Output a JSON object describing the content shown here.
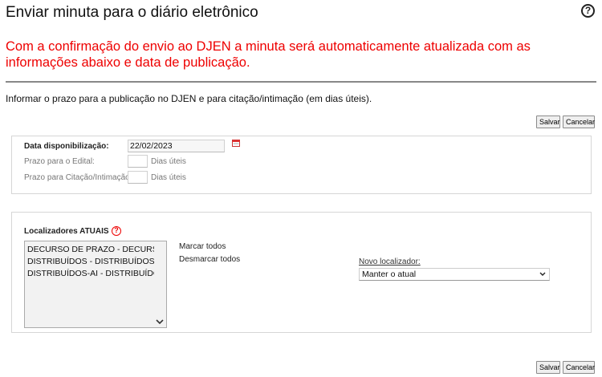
{
  "header": {
    "title": "Enviar minuta para o diário eletrônico",
    "help_icon": "question-circle-icon"
  },
  "warning": "Com a confirmação do envio ao DJEN a minuta será automaticamente atualizada com as informações abaixo e data de publicação.",
  "instruction": "Informar o prazo para a publicação no DJEN e para citação/intimação (em dias úteis).",
  "buttons": {
    "save": "Salvar",
    "cancel": "Cancelar"
  },
  "form": {
    "data_label": "Data disponibilização:",
    "data_value": "22/02/2023",
    "edital_label": "Prazo para o Edital:",
    "edital_value": "",
    "edital_unit": "Dias úteis",
    "citacao_label": "Prazo para Citação/Intimação:",
    "citacao_value": "",
    "citacao_unit": "Dias úteis"
  },
  "localizadores": {
    "label": "Localizadores ATUAIS",
    "items": [
      "DECURSO DE PRAZO - DECURSO DE PRAZO",
      "DISTRIBUÍDOS - DISTRIBUÍDOS",
      "DISTRIBUÍDOS-AI - DISTRIBUÍDOS-AI"
    ],
    "mark_all": "Marcar todos",
    "unmark_all": "Desmarcar todos",
    "novo_label": "Novo localizador:",
    "novo_value": "Manter o atual"
  },
  "colors": {
    "warning": "#ee0000",
    "help_red": "#ee0000"
  }
}
